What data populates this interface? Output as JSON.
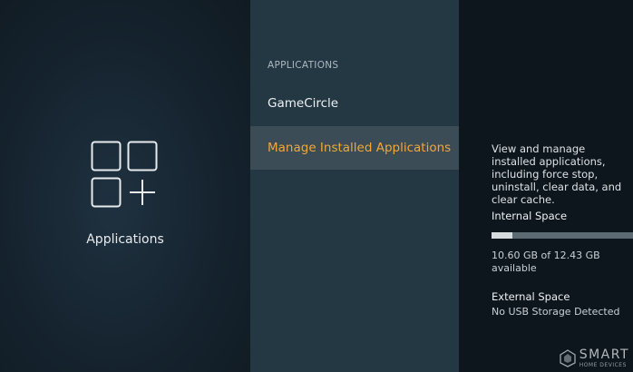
{
  "left": {
    "icon": "applications-grid-plus-icon",
    "label": "Applications"
  },
  "menu": {
    "header": "APPLICATIONS",
    "items": [
      {
        "label": "GameCircle",
        "selected": false
      },
      {
        "label": "Manage Installed Applications",
        "selected": true
      }
    ],
    "accent_color": "#f2a738"
  },
  "details": {
    "description": "View and manage installed applications, including force stop, uninstall, clear data, and clear cache.",
    "internal": {
      "title": "Internal Space",
      "value": "10.60 GB of 12.43 GB available",
      "fill_fraction": 0.15
    },
    "external": {
      "title": "External Space",
      "value": "No USB Storage Detected"
    }
  },
  "watermark": {
    "brand": "SMART",
    "sub": "HOME DEVICES"
  }
}
